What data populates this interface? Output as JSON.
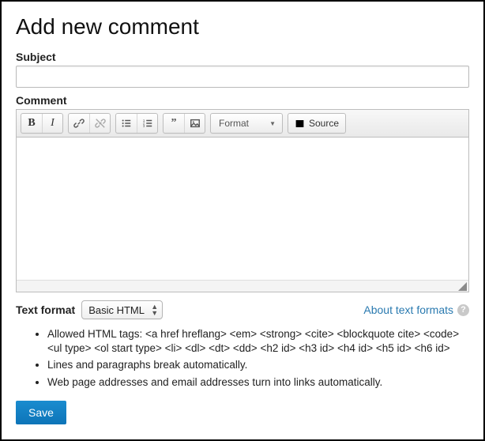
{
  "page": {
    "title": "Add new comment"
  },
  "subject": {
    "label": "Subject",
    "value": "",
    "placeholder": ""
  },
  "comment": {
    "label": "Comment",
    "value": ""
  },
  "editor_toolbar": {
    "bold_glyph": "B",
    "italic_glyph": "I",
    "format_label": "Format",
    "source_label": "Source",
    "icons": {
      "bold": "bold-icon",
      "italic": "italic-icon",
      "link": "link-icon",
      "unlink": "unlink-icon",
      "bulleted_list": "bulleted-list-icon",
      "numbered_list": "numbered-list-icon",
      "blockquote": "blockquote-icon",
      "image": "image-icon",
      "source": "source-icon"
    }
  },
  "text_format": {
    "label": "Text format",
    "selected": "Basic HTML",
    "about_link_text": "About text formats",
    "tips": [
      "Allowed HTML tags: <a href hreflang> <em> <strong> <cite> <blockquote cite> <code> <ul type> <ol start type> <li> <dl> <dt> <dd> <h2 id> <h3 id> <h4 id> <h5 id> <h6 id>",
      "Lines and paragraphs break automatically.",
      "Web page addresses and email addresses turn into links automatically."
    ]
  },
  "actions": {
    "save_label": "Save"
  },
  "colors": {
    "primary_button": "#0d79bf",
    "link": "#2a7ab0"
  }
}
